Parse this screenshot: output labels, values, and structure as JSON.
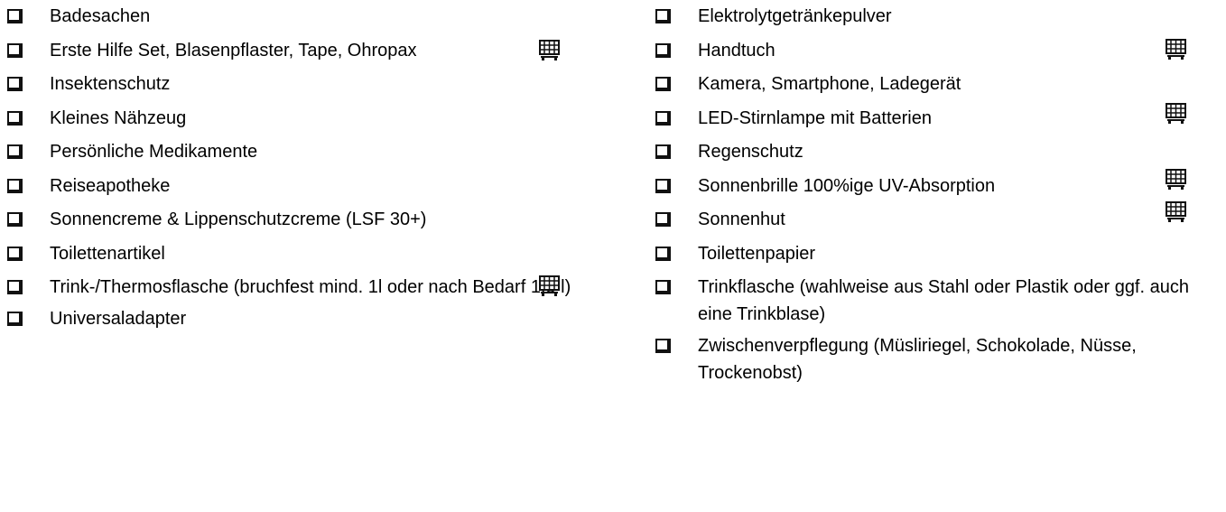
{
  "checklist": {
    "left": [
      {
        "label": "Badesachen",
        "cart": false
      },
      {
        "label": "Erste Hilfe Set, Blasenpflaster, Tape, Ohropax",
        "cart": true
      },
      {
        "label": "Insektenschutz",
        "cart": false
      },
      {
        "label": "Kleines Nähzeug",
        "cart": false
      },
      {
        "label": "Persönliche Medikamente",
        "cart": false
      },
      {
        "label": "Reiseapotheke",
        "cart": false
      },
      {
        "label": "Sonnencreme & Lippenschutzcreme (LSF 30+)",
        "cart": false
      },
      {
        "label": "Toilettenartikel",
        "cart": false
      },
      {
        "label": "Trink-/Thermosflasche (bruchfest mind. 1l oder nach Bedarf 1,5 l)",
        "cart": true
      },
      {
        "label": "Universaladapter",
        "cart": false
      }
    ],
    "right": [
      {
        "label": "Elektrolytgetränkepulver",
        "cart": false
      },
      {
        "label": "Handtuch",
        "cart": true
      },
      {
        "label": "Kamera, Smartphone, Ladegerät",
        "cart": false
      },
      {
        "label": "LED-Stirnlampe mit Batterien",
        "cart": true
      },
      {
        "label": "Regenschutz",
        "cart": false
      },
      {
        "label": "Sonnenbrille 100%ige UV-Absorption",
        "cart": true
      },
      {
        "label": "Sonnenhut",
        "cart": true
      },
      {
        "label": "Toilettenpapier",
        "cart": false
      },
      {
        "label": "Trinkflasche (wahlweise aus Stahl oder Plastik oder ggf. auch eine Trinkblase)",
        "cart": false
      },
      {
        "label": "Zwischenverpflegung (Müsliriegel, Schokolade, Nüsse, Trockenobst)",
        "cart": false
      }
    ]
  },
  "icons": {
    "checkbox": "checkbox-icon",
    "cart": "shopping-cart-icon"
  }
}
